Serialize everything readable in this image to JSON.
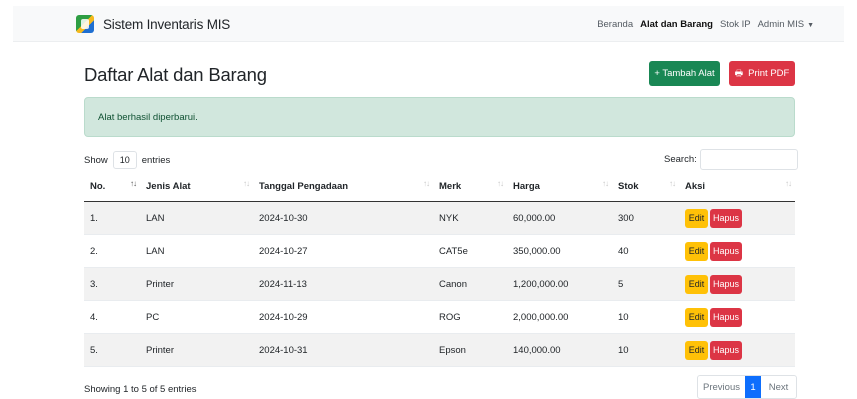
{
  "navbar": {
    "brand": "Sistem Inventaris MIS",
    "items": [
      {
        "label": "Beranda",
        "active": false
      },
      {
        "label": "Alat dan Barang",
        "active": true
      },
      {
        "label": "Stok IP",
        "active": false
      }
    ],
    "user": "Admin MIS",
    "user_icon": "caret-down-icon"
  },
  "page": {
    "title": "Daftar Alat dan Barang",
    "add_button": "+ Tambah Alat",
    "pdf_button": "Print PDF",
    "pdf_icon": "printer-icon"
  },
  "alert": {
    "message": "Alat berhasil diperbarui."
  },
  "table_controls": {
    "show_label": "Show",
    "entries_value": "10",
    "entries_label": "entries",
    "search_label": "Search:",
    "search_value": ""
  },
  "table": {
    "columns": [
      "No.",
      "Jenis Alat",
      "Tanggal Pengadaan",
      "Merk",
      "Harga",
      "Stok",
      "Aksi"
    ],
    "rows": [
      {
        "no": "1.",
        "jenis": "LAN",
        "tanggal": "2024-10-30",
        "merk": "NYK",
        "harga": "60,000.00",
        "stok": "300"
      },
      {
        "no": "2.",
        "jenis": "LAN",
        "tanggal": "2024-10-27",
        "merk": "CAT5e",
        "harga": "350,000.00",
        "stok": "40"
      },
      {
        "no": "3.",
        "jenis": "Printer",
        "tanggal": "2024-11-13",
        "merk": "Canon",
        "harga": "1,200,000.00",
        "stok": "5"
      },
      {
        "no": "4.",
        "jenis": "PC",
        "tanggal": "2024-10-29",
        "merk": "ROG",
        "harga": "2,000,000.00",
        "stok": "10"
      },
      {
        "no": "5.",
        "jenis": "Printer",
        "tanggal": "2024-10-31",
        "merk": "Epson",
        "harga": "140,000.00",
        "stok": "10"
      }
    ],
    "edit_label": "Edit",
    "delete_label": "Hapus"
  },
  "footer": {
    "info": "Showing 1 to 5 of 5 entries",
    "previous": "Previous",
    "page": "1",
    "next": "Next"
  },
  "colors": {
    "success": "#198754",
    "danger": "#dc3545",
    "warning": "#ffc107",
    "primary": "#0d6efd",
    "alert_bg": "#d1e7dd"
  }
}
